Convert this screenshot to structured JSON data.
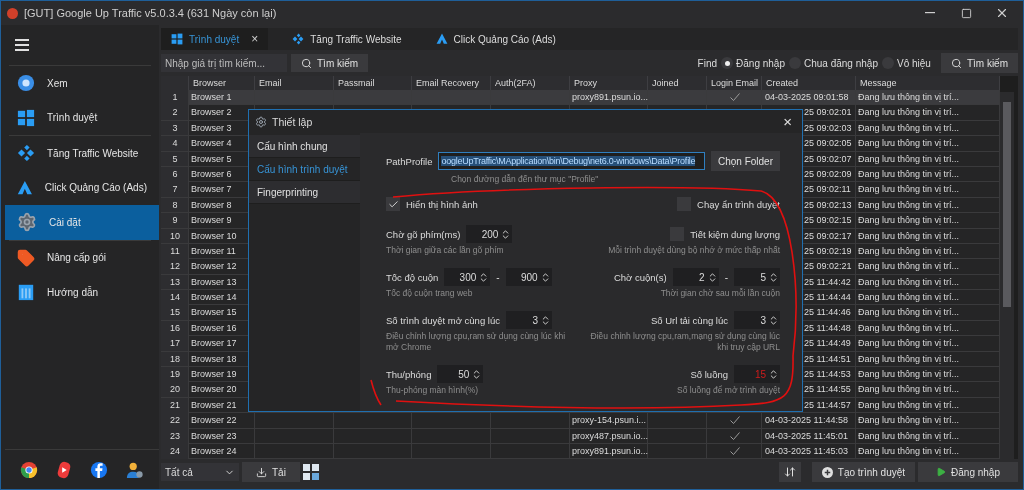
{
  "window": {
    "title": "[GUT] Google Up Traffic v5.0.3.4 (631 Ngày còn lại)"
  },
  "sidebar": {
    "items": [
      {
        "label": "Xem",
        "selected": false
      },
      {
        "label": "Trình duyệt",
        "selected": false
      },
      {
        "label": "Tăng Traffic Website",
        "selected": false
      },
      {
        "label": "Click Quảng Cáo (Ads)",
        "selected": false
      },
      {
        "label": "Cài đặt",
        "selected": true
      },
      {
        "label": "Nâng cấp gói",
        "selected": false
      },
      {
        "label": "Hướng dẫn",
        "selected": false
      }
    ]
  },
  "tabs": [
    {
      "label": "Trình duyệt",
      "selected": true,
      "close": "×"
    },
    {
      "label": "Tăng Traffic Website",
      "selected": false
    },
    {
      "label": "Click Quảng Cáo (Ads)",
      "selected": false
    }
  ],
  "search": {
    "placeholder": "Nhập giá trị tìm kiếm...",
    "button": "Tìm kiếm"
  },
  "filter": {
    "label": "Find",
    "options": [
      {
        "label": "Đăng nhập",
        "selected": true
      },
      {
        "label": "Chua đăng nhập",
        "selected": false
      },
      {
        "label": "Vô hiệu",
        "selected": false
      }
    ],
    "button": "Tìm kiếm"
  },
  "table": {
    "columns": [
      "Browser",
      "Email",
      "Passmail",
      "Email Recovery",
      "Auth(2FA)",
      "Proxy",
      "Joined",
      "Login Email",
      "Created",
      "Message"
    ],
    "rows": [
      {
        "kind": "full",
        "selected": true,
        "num": "1",
        "browser": "Browser 1",
        "proxy": "proxy891.psun.io...",
        "login_email": true,
        "created": "04-03-2025 09:01:58",
        "message": "Đang lưu thông tin vị trí..."
      },
      {
        "kind": "under_dialog",
        "selected": false,
        "num": "2",
        "browser": "Browser 2",
        "created": "25 09:02:01",
        "message": "Đang lưu thông tin vị trí..."
      },
      {
        "kind": "under_dialog",
        "selected": false,
        "num": "3",
        "browser": "Browser 3",
        "created": "25 09:02:03",
        "message": "Đang lưu thông tin vị trí..."
      },
      {
        "kind": "under_dialog",
        "selected": false,
        "num": "4",
        "browser": "Browser 4",
        "created": "25 09:02:05",
        "message": "Đang lưu thông tin vị trí..."
      },
      {
        "kind": "under_dialog",
        "selected": false,
        "num": "5",
        "browser": "Browser 5",
        "created": "25 09:02:07",
        "message": "Đang lưu thông tin vị trí..."
      },
      {
        "kind": "under_dialog",
        "selected": false,
        "num": "6",
        "browser": "Browser 6",
        "created": "25 09:02:09",
        "message": "Đang lưu thông tin vị trí..."
      },
      {
        "kind": "under_dialog",
        "selected": false,
        "num": "7",
        "browser": "Browser 7",
        "created": "25 09:02:11",
        "message": "Đang lưu thông tin vị trí..."
      },
      {
        "kind": "under_dialog",
        "selected": false,
        "num": "8",
        "browser": "Browser 8",
        "created": "25 09:02:13",
        "message": "Đang lưu thông tin vị trí..."
      },
      {
        "kind": "under_dialog",
        "selected": false,
        "num": "9",
        "browser": "Browser 9",
        "created": "25 09:02:15",
        "message": "Đang lưu thông tin vị trí..."
      },
      {
        "kind": "under_dialog",
        "selected": false,
        "num": "10",
        "browser": "Browser 10",
        "created": "25 09:02:17",
        "message": "Đang lưu thông tin vị trí..."
      },
      {
        "kind": "under_dialog",
        "selected": false,
        "num": "11",
        "browser": "Browser 11",
        "created": "25 09:02:19",
        "message": "Đang lưu thông tin vị trí..."
      },
      {
        "kind": "under_dialog",
        "selected": false,
        "num": "12",
        "browser": "Browser 12",
        "created": "25 09:02:21",
        "message": "Đang lưu thông tin vị trí..."
      },
      {
        "kind": "under_dialog",
        "selected": false,
        "num": "13",
        "browser": "Browser 13",
        "created": "25 11:44:42",
        "message": "Đang lưu thông tin vị trí..."
      },
      {
        "kind": "under_dialog",
        "selected": false,
        "num": "14",
        "browser": "Browser 14",
        "created": "25 11:44:44",
        "message": "Đang lưu thông tin vị trí..."
      },
      {
        "kind": "under_dialog",
        "selected": false,
        "num": "15",
        "browser": "Browser 15",
        "created": "25 11:44:46",
        "message": "Đang lưu thông tin vị trí..."
      },
      {
        "kind": "under_dialog",
        "selected": false,
        "num": "16",
        "browser": "Browser 16",
        "created": "25 11:44:48",
        "message": "Đang lưu thông tin vị trí..."
      },
      {
        "kind": "under_dialog",
        "selected": false,
        "num": "17",
        "browser": "Browser 17",
        "created": "25 11:44:49",
        "message": "Đang lưu thông tin vị trí..."
      },
      {
        "kind": "under_dialog",
        "selected": false,
        "num": "18",
        "browser": "Browser 18",
        "created": "25 11:44:51",
        "message": "Đang lưu thông tin vị trí..."
      },
      {
        "kind": "under_dialog",
        "selected": false,
        "num": "19",
        "browser": "Browser 19",
        "created": "25 11:44:53",
        "message": "Đang lưu thông tin vị trí..."
      },
      {
        "kind": "under_dialog",
        "selected": false,
        "num": "20",
        "browser": "Browser 20",
        "created": "25 11:44:55",
        "message": "Đang lưu thông tin vị trí..."
      },
      {
        "kind": "under_dialog",
        "selected": false,
        "num": "21",
        "browser": "Browser 21",
        "created": "25 11:44:57",
        "message": "Đang lưu thông tin vị trí..."
      },
      {
        "kind": "full",
        "selected": false,
        "num": "22",
        "browser": "Browser 22",
        "proxy": "proxy-154.psun.i...",
        "login_email": true,
        "created": "04-03-2025 11:44:58",
        "message": "Đang lưu thông tin vị trí..."
      },
      {
        "kind": "full",
        "selected": false,
        "num": "23",
        "browser": "Browser 23",
        "proxy": "proxy487.psun.io...",
        "login_email": true,
        "created": "04-03-2025 11:45:01",
        "message": "Đang lưu thông tin vị trí..."
      },
      {
        "kind": "full",
        "selected": false,
        "num": "24",
        "browser": "Browser 24",
        "proxy": "proxy891.psun.io...",
        "login_email": true,
        "created": "04-03-2025 11:45:03",
        "message": "Đang lưu thông tin vị trí..."
      }
    ]
  },
  "bottom_bar": {
    "select": "Tất cả",
    "load_button": "Tải",
    "create_button": "Tạo trình duyệt",
    "login_button": "Đăng nhập"
  },
  "dialog": {
    "title": "Thiết lập",
    "close": "×",
    "nav": [
      {
        "label": "Cấu hình chung",
        "selected": false
      },
      {
        "label": "Cấu hình trình duyệt",
        "selected": true
      },
      {
        "label": "Fingerprinting",
        "selected": false
      }
    ],
    "path": {
      "label": "PathProfile",
      "value": "oogleUpTraffic\\MApplication\\bin\\Debug\\net6.0-windows\\Data\\Profile",
      "button": "Chọn Folder",
      "hint": "Chọn đường dẫn đến thư mục \"Profile\""
    },
    "rows": [
      {
        "left": {
          "kind": "checkbox",
          "label": "Hiển thị hình ảnh",
          "checked": true
        },
        "right": {
          "kind": "checkbox",
          "label": "Chạy ẩn trình duyệt",
          "checked": false
        }
      },
      {
        "left": {
          "kind": "spinner",
          "label": "Chờ gõ phím(ms)",
          "values": [
            {
              "value": "200",
              "warning": false
            }
          ],
          "hint": "Thời gian giữa các lần gõ phím"
        },
        "right": {
          "kind": "checkbox",
          "label": "Tiết kiệm dung lượng",
          "checked": false,
          "hint": "Mỗi trình duyệt dùng bộ nhớ ở mức thấp nhất"
        }
      },
      {
        "left": {
          "kind": "spinner",
          "label": "Tốc độ cuộn",
          "values": [
            {
              "value": "300",
              "warning": false
            },
            {
              "value": "900",
              "warning": false
            }
          ],
          "separator": "-",
          "hint": "Tốc độ cuộn trang web"
        },
        "right": {
          "kind": "spinner",
          "label": "Chờ cuộn(s)",
          "values": [
            {
              "value": "2",
              "warning": false
            },
            {
              "value": "5",
              "warning": false
            }
          ],
          "separator": "-",
          "hint": "Thời gian chờ sau mỗi lần cuộn"
        }
      },
      {
        "left": {
          "kind": "spinner",
          "label": "Số trình duyệt mở cùng lúc",
          "values": [
            {
              "value": "3",
              "warning": false
            }
          ],
          "hint": "Điều chỉnh lượng cpu,ram sử dụng cùng lúc khi mở Chrome"
        },
        "right": {
          "kind": "spinner",
          "label": "Số Url tải cùng lúc",
          "values": [
            {
              "value": "3",
              "warning": false
            }
          ],
          "hint": "Điều chỉnh lượng cpu,ram,mạng sử dụng cùng lúc khi truy cập URL"
        }
      },
      {
        "left": {
          "kind": "spinner",
          "label": "Thu/phóng",
          "values": [
            {
              "value": "50",
              "warning": false
            }
          ],
          "hint": "Thu-phóng màn hình(%)"
        },
        "right": {
          "kind": "spinner",
          "label": "Số luồng",
          "values": [
            {
              "value": "15",
              "warning": true
            }
          ],
          "hint": "Số luồng để mở trình duyệt"
        }
      }
    ]
  }
}
